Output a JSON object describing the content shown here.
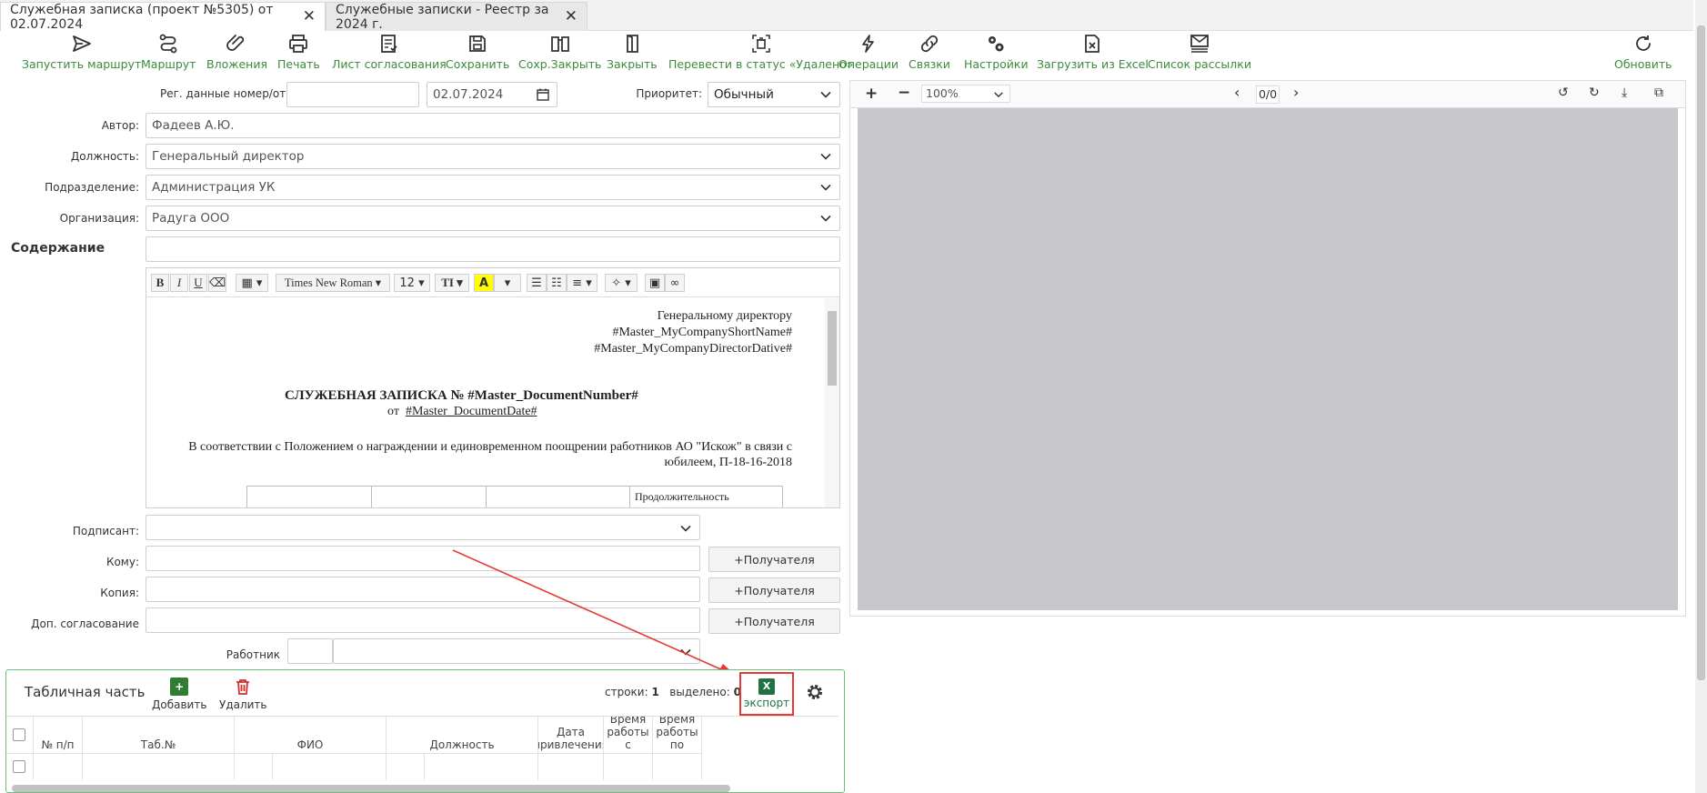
{
  "tabs": [
    {
      "label": "Служебная записка (проект №5305) от 02.07.2024"
    },
    {
      "label": "Служебные записки - Реестр за 2024 г."
    }
  ],
  "toolbar": {
    "start_route": "Запустить маршрут",
    "route": "Маршрут",
    "attachments": "Вложения",
    "print": "Печать",
    "approval_sheet": "Лист согласования",
    "save": "Сохранить",
    "save_close": "Сохр.Закрыть",
    "close": "Закрыть",
    "to_deleted": "Перевести в статус «Удалено»",
    "operations": "Операции",
    "links": "Связки",
    "settings": "Настройки",
    "load_excel": "Загрузить из Excel",
    "mailing_list": "Список рассылки",
    "refresh": "Обновить"
  },
  "form": {
    "reg_label": "Рег. данные номер/от:",
    "reg_number": "",
    "reg_date": "02.07.2024",
    "priority_label": "Приоритет:",
    "priority_value": "Обычный",
    "author_label": "Автор:",
    "author_value": "Фадеев А.Ю.",
    "position_label": "Должность:",
    "position_value": "Генеральный директор",
    "department_label": "Подразделение:",
    "department_value": "Администрация УК",
    "organization_label": "Организация:",
    "organization_value": "Радуга ООО",
    "content_title": "Содержание",
    "signer_label": "Подписант:",
    "to_label": "Кому:",
    "copy_label": "Копия:",
    "extra_approval_label": "Доп. согласование",
    "worker_label": "Работник",
    "add_recipient": "+Получателя"
  },
  "editor": {
    "font_name": "Times New Roman",
    "font_size": "12",
    "line1": "Генеральному директору",
    "line2": "#Master_MyCompanyShortName#",
    "line3": "#Master_MyCompanyDirectorDative#",
    "heading": "СЛУЖЕБНАЯ ЗАПИСКА № #Master_DocumentNumber#",
    "date_prefix": "от",
    "date_var": "#Master_DocumentDate#",
    "para1": "В соответствии с Положением о награждении и единовременном поощрении работников АО \"Искож\" в связи с",
    "para2": "юбилеем,  П-18-16-2018",
    "table_cell": "Продолжительность"
  },
  "preview": {
    "zoom": "100%",
    "page_counter": "0/0"
  },
  "table_panel": {
    "title": "Табличная часть",
    "add": "Добавить",
    "delete": "Удалить",
    "rows_label": "строки:",
    "rows_count": "1",
    "selected_label": "выделено:",
    "selected_count": "0",
    "export": "экспорт",
    "excel_letter": "X",
    "columns": [
      "№ п/п",
      "Таб.№",
      "ФИО",
      "Должность",
      "Дата привлечения",
      "Время работы с",
      "Время работы по"
    ]
  },
  "colors": {
    "accent_green": "#3c8b3a",
    "highlight_red": "#e53935",
    "panel_border": "#6abf7b"
  }
}
